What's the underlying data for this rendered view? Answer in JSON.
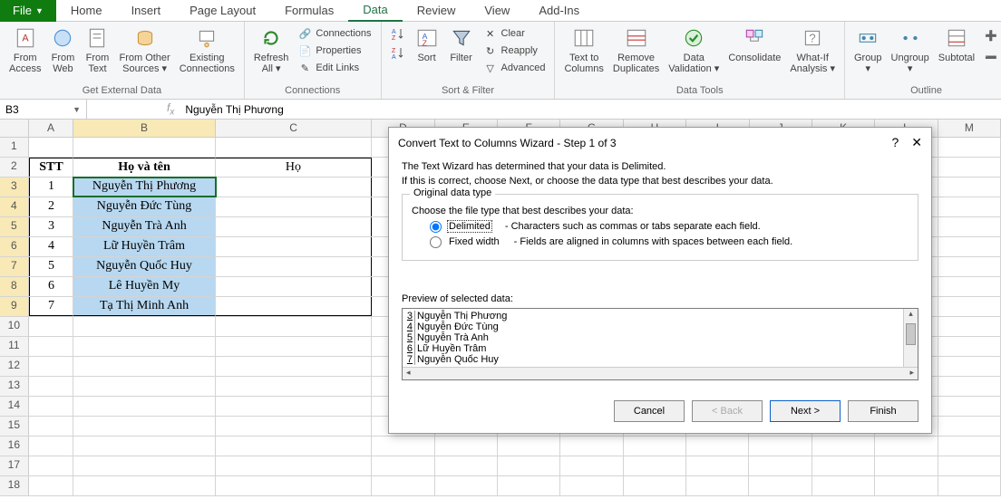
{
  "tabs": {
    "file": "File",
    "home": "Home",
    "insert": "Insert",
    "pagelayout": "Page Layout",
    "formulas": "Formulas",
    "data": "Data",
    "review": "Review",
    "view": "View",
    "addins": "Add-Ins"
  },
  "ribbon": {
    "ext": {
      "access": "From\nAccess",
      "web": "From\nWeb",
      "text": "From\nText",
      "other": "From Other\nSources ▾",
      "existing": "Existing\nConnections",
      "group": "Get External Data"
    },
    "conn": {
      "refresh": "Refresh\nAll ▾",
      "connections": "Connections",
      "properties": "Properties",
      "editlinks": "Edit Links",
      "group": "Connections"
    },
    "sort": {
      "sort": "Sort",
      "filter": "Filter",
      "clear": "Clear",
      "reapply": "Reapply",
      "advanced": "Advanced",
      "group": "Sort & Filter"
    },
    "tools": {
      "t2c": "Text to\nColumns",
      "rmdup": "Remove\nDuplicates",
      "valid": "Data\nValidation ▾",
      "consol": "Consolidate",
      "whatif": "What-If\nAnalysis ▾",
      "group": "Data Tools"
    },
    "outline": {
      "group": "Group\n▾",
      "ungroup": "Ungroup\n▾",
      "subtotal": "Subtotal",
      "glabel": "Outline"
    }
  },
  "fbar": {
    "name": "B3",
    "fval": "Nguyễn Thị Phương"
  },
  "headers": {
    "A": "STT",
    "B": "Họ và tên",
    "C": "Họ"
  },
  "table": [
    {
      "n": "1",
      "name": "Nguyễn Thị Phương"
    },
    {
      "n": "2",
      "name": "Nguyễn Đức Tùng"
    },
    {
      "n": "3",
      "name": "Nguyễn Trà Anh"
    },
    {
      "n": "4",
      "name": "Lữ Huyền Trâm"
    },
    {
      "n": "5",
      "name": "Nguyễn Quốc Huy"
    },
    {
      "n": "6",
      "name": "Lê Huyền My"
    },
    {
      "n": "7",
      "name": "Tạ Thị Minh Anh"
    }
  ],
  "wizard": {
    "title": "Convert Text to Columns Wizard - Step 1 of 3",
    "intro1": "The Text Wizard has determined that your data is Delimited.",
    "intro2": "If this is correct, choose Next, or choose the data type that best describes your data.",
    "legend": "Original data type",
    "choose": "Choose the file type that best describes your data:",
    "delimited": "Delimited",
    "delimited_desc": "- Characters such as commas or tabs separate each field.",
    "fixed": "Fixed width",
    "fixed_desc": "- Fields are aligned in columns with spaces between each field.",
    "preview_label": "Preview of selected data:",
    "preview": [
      {
        "n": "3",
        "t": "Nguyễn Thị Phương"
      },
      {
        "n": "4",
        "t": "Nguyễn Đức Tùng"
      },
      {
        "n": "5",
        "t": "Nguyễn Trà Anh"
      },
      {
        "n": "6",
        "t": "Lữ Huyền Trâm"
      },
      {
        "n": "7",
        "t": "Nguyễn Quốc Huy"
      }
    ],
    "cancel": "Cancel",
    "back": "< Back",
    "next": "Next >",
    "finish": "Finish",
    "help": "?",
    "close": "✕"
  }
}
